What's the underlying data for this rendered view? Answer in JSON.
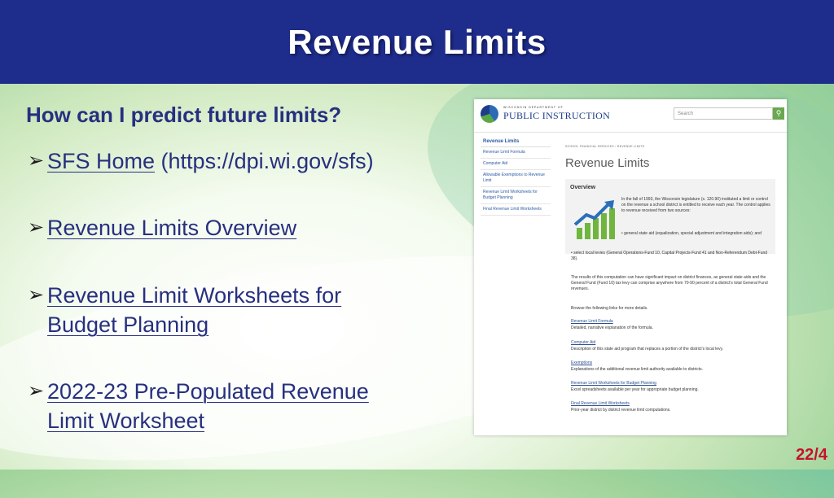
{
  "slide": {
    "title": "Revenue Limits",
    "subtitle": "How can I predict future limits?",
    "bullets": [
      {
        "link": "SFS Home",
        "plain": " (https://dpi.wi.gov/sfs)"
      },
      {
        "link": "Revenue Limits Overview"
      },
      {
        "link": "Revenue Limit Worksheets for Budget Planning"
      },
      {
        "link": "2022-23 Pre-Populated Revenue Limit Worksheet"
      }
    ],
    "page_number": "22/4",
    "bullet_icon": "arrow-bullet-icon",
    "colors": {
      "header": "#1e2c8c",
      "text": "#27307f",
      "page_number": "#c8102e"
    }
  },
  "screenshot": {
    "logo_small": "WISCONSIN DEPARTMENT OF",
    "logo_main": "PUBLIC INSTRUCTION",
    "search_placeholder": "Search",
    "sidebar": {
      "heading": "Revenue Limits",
      "items": [
        "Revenue Limit Formula",
        "Computer Aid",
        "Allowable Exemptions to Revenue Limit",
        "Revenue Limit Worksheets for Budget Planning",
        "Final Revenue Limit Worksheets"
      ]
    },
    "breadcrumb": "SCHOOL FINANCIAL SERVICES  ›  REVENUE LIMITS",
    "page_title": "Revenue Limits",
    "overview": {
      "title": "Overview",
      "p1": "In the fall of 1993, the Wisconsin legislature (s. 120.90) instituted a limit or control on the revenue a school district is entitled to receive each year. The control applies to revenue received from two sources:",
      "p2": "• general state aid (equalization, special adjustment and integration aids); and"
    },
    "levies": "• select local levies (General Operations-Fund 10, Capital Projects-Fund 41 and Non-Referendum Debt-Fund 38).",
    "results": "The results of this computation can have significant impact on district finances, as general state aids and the General Fund (Fund 10) tax levy can comprise anywhere from 70-90 percent of a district's total General Fund revenues.",
    "browse": "Browse the following links for more details.",
    "links": [
      {
        "title": "Revenue Limit Formula",
        "desc": "Detailed, narrative explanation of the formula."
      },
      {
        "title": "Computer Aid",
        "desc": "Description of this state aid program that replaces a portion of the district's local levy."
      },
      {
        "title": "Exemptions",
        "desc": "Explanations of the additional revenue limit authority available to districts."
      },
      {
        "title": "Revenue Limit Worksheets for Budget Planning",
        "desc": "Excel spreadsheets available per year for appropriate budget planning."
      },
      {
        "title": "Final Revenue Limit Worksheets",
        "desc": "Prior-year district by district revenue limit computations."
      }
    ]
  }
}
